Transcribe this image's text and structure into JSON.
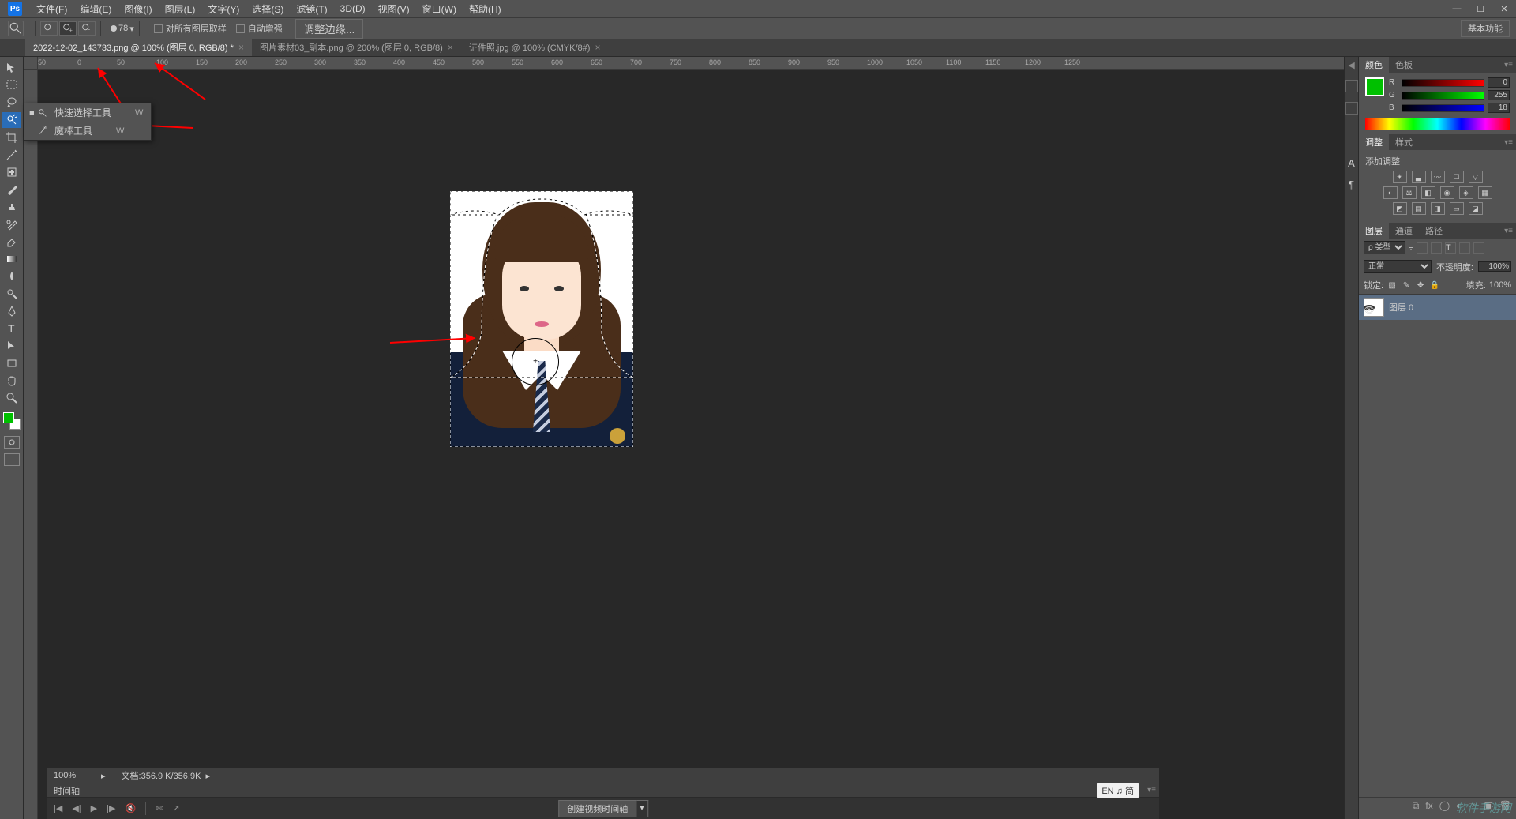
{
  "app": {
    "name": "Ps"
  },
  "menu": {
    "file": "文件(F)",
    "edit": "编辑(E)",
    "image": "图像(I)",
    "layer": "图层(L)",
    "text": "文字(Y)",
    "select": "选择(S)",
    "filter": "滤镜(T)",
    "threeD": "3D(D)",
    "view": "视图(V)",
    "window": "窗口(W)",
    "help": "帮助(H)"
  },
  "options": {
    "brushSize": "78",
    "sampleAll": "对所有图层取样",
    "autoEnhance": "自动增强",
    "refineEdge": "调整边缘...",
    "workspace": "基本功能"
  },
  "tabs": {
    "t1": "2022-12-02_143733.png @ 100% (图层 0, RGB/8) *",
    "t2": "图片素材03_副本.png @ 200% (图层 0, RGB/8)",
    "t3": "证件照.jpg @ 100% (CMYK/8#)"
  },
  "flyout": {
    "quickSelect": "快速选择工具",
    "magicWand": "魔棒工具",
    "shortcut": "W"
  },
  "status": {
    "zoom": "100%",
    "docInfo": "文档:356.9 K/356.9K"
  },
  "timeline": {
    "label": "时间轴",
    "createBtn": "创建视频时间轴"
  },
  "ime": "EN ♫ 简",
  "panels": {
    "colorTab": "颜色",
    "swatchesTab": "色板",
    "rgb": {
      "r": "0",
      "g": "255",
      "b": "18"
    },
    "adjustTab": "调整",
    "stylesTab": "样式",
    "addAdjust": "添加调整",
    "layersTab": "图层",
    "channelsTab": "通道",
    "pathsTab": "路径",
    "filterLabel": "ρ 类型",
    "blendMode": "正常",
    "opacityLabel": "不透明度:",
    "opacity": "100%",
    "lockLabel": "锁定:",
    "fillLabel": "填充:",
    "fill": "100%",
    "layer0": "图层 0"
  },
  "rulerH": [
    "50",
    "0",
    "50",
    "100",
    "150",
    "200",
    "250",
    "300",
    "350",
    "400",
    "450",
    "500",
    "550",
    "600",
    "650",
    "700",
    "750",
    "800",
    "850",
    "900",
    "950",
    "1000",
    "1050",
    "1100",
    "1150",
    "1200",
    "1250"
  ],
  "watermark": "软件手游网"
}
